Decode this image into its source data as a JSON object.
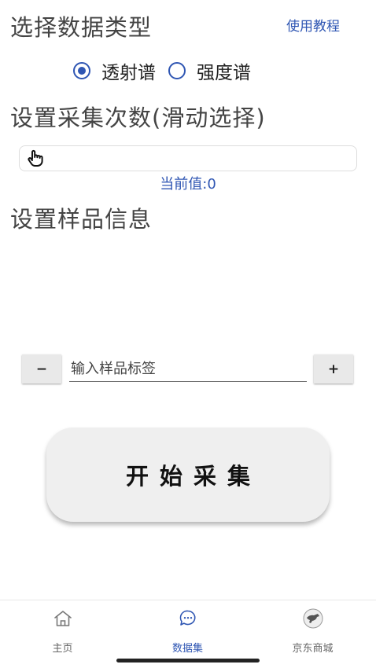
{
  "select_type": {
    "title": "选择数据类型",
    "tutorial_link": "使用教程",
    "options": [
      {
        "label": "透射谱",
        "selected": true
      },
      {
        "label": "强度谱",
        "selected": false
      }
    ]
  },
  "count": {
    "title": "设置采集次数(滑动选择)",
    "current_label": "当前值:",
    "current_value": "0",
    "value": 0
  },
  "sample": {
    "title": "设置样品信息",
    "minus_label": "−",
    "plus_label": "+",
    "input_placeholder": "输入样品标签",
    "input_value": ""
  },
  "start_button": "开始采集",
  "tabs": [
    {
      "label": "主页",
      "icon": "home-icon",
      "active": false
    },
    {
      "label": "数据集",
      "icon": "chat-bubble-icon",
      "active": true
    },
    {
      "label": "京东商城",
      "icon": "jd-dog-icon",
      "active": false
    }
  ],
  "colors": {
    "accent": "#2f56b3",
    "title_text": "#444444",
    "button_bg": "#efefef"
  }
}
